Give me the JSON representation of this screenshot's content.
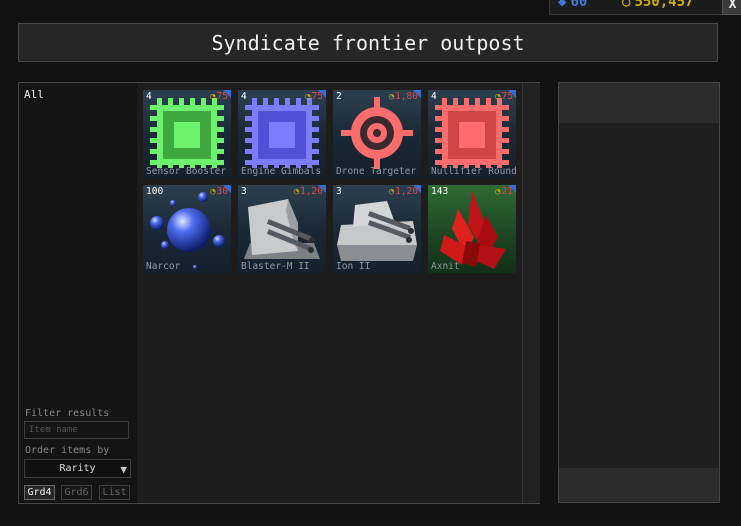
{
  "header": {
    "title": "Syndicate frontier outpost",
    "currency_a": "60",
    "currency_b": "550,457",
    "close_label": "X"
  },
  "sidebar": {
    "categories": [
      {
        "label": "All"
      }
    ],
    "filter_label": "Filter results",
    "filter_placeholder": "Item name",
    "order_label": "Order items by",
    "order_value": "Rarity",
    "view_buttons": [
      {
        "label": "Grd4",
        "active": true
      },
      {
        "label": "Grd6",
        "active": false
      },
      {
        "label": "List",
        "active": false
      }
    ]
  },
  "items": [
    {
      "name": "Sensor Booster",
      "qty": "4",
      "price": "75",
      "icon": "chip-green-icon"
    },
    {
      "name": "Engine Gimbals",
      "qty": "4",
      "price": "75",
      "icon": "chip-blue-icon"
    },
    {
      "name": "Drone Targeter",
      "qty": "2",
      "price": "1,80",
      "icon": "crosshair-icon"
    },
    {
      "name": "Nullifier Round",
      "qty": "4",
      "price": "75",
      "icon": "chip-red-icon"
    },
    {
      "name": "Narcor",
      "qty": "100",
      "price": "30",
      "icon": "blue-orbs-icon"
    },
    {
      "name": "Blaster-M II",
      "qty": "3",
      "price": "1,20",
      "icon": "turret-icon"
    },
    {
      "name": "Ion II",
      "qty": "3",
      "price": "1,20",
      "icon": "turret-icon"
    },
    {
      "name": "Axnit",
      "qty": "143",
      "price": "21",
      "icon": "red-crystal-icon"
    }
  ],
  "colors": {
    "price": "#e04848",
    "coin": "#d8b000",
    "chip_green": "#6cf26c",
    "chip_blue": "#7c7cff",
    "chip_red": "#ff6c6c"
  }
}
